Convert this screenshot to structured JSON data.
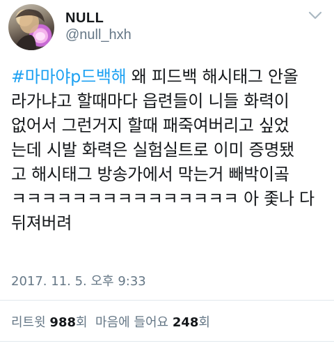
{
  "user": {
    "display_name": "NULL",
    "handle": "@null_hxh"
  },
  "tweet": {
    "hashtag": "#마마야p드백해",
    "line1_rest": " 왜 피드백 해시태그 안올",
    "lines": [
      "라가냐고 할때마다 읍련들이 니들 화력이",
      "없어서 그런거지 할때 패죽여버리고 싶었",
      "는데 시발 화력은 실험실트로 이미 증명됐",
      "고 해시태그 방송가에서 막는거 빼박이곸",
      "ㅋㅋㅋㅋㅋㅋㅋㅋㅋㅋㅋㅋㅋㅋㅋ 아 좇나 다",
      "뒤져버려"
    ],
    "timestamp": "2017. 11. 5. 오후 9:33"
  },
  "stats": {
    "retweet_label": "리트윗",
    "retweet_count": "988",
    "retweet_unit": "회",
    "like_label": "마음에 들어요",
    "like_count": "248",
    "like_unit": "회"
  },
  "icons": {
    "caret": "chevron-down-icon"
  },
  "colors": {
    "hashtag": "#1da1f2",
    "secondary_text": "#657786",
    "primary_text": "#14171a",
    "divider": "#e1e8ed"
  }
}
